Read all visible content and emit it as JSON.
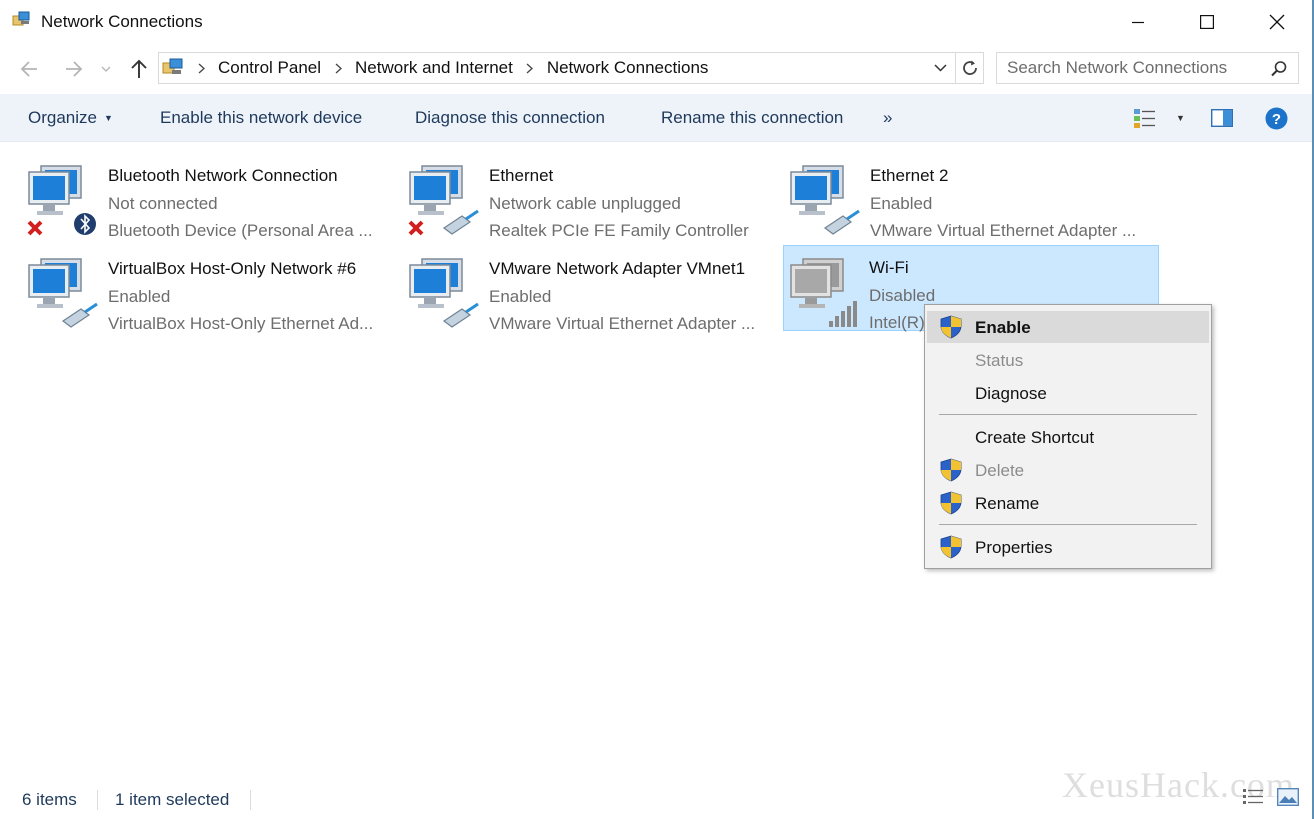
{
  "window": {
    "title": "Network Connections"
  },
  "nav": {
    "breadcrumbs": [
      "Control Panel",
      "Network and Internet",
      "Network Connections"
    ],
    "search_placeholder": "Search Network Connections"
  },
  "commands": {
    "organize": "Organize",
    "enable_device": "Enable this network device",
    "diagnose": "Diagnose this connection",
    "rename": "Rename this connection",
    "more": "»"
  },
  "connections": [
    {
      "name": "Bluetooth Network Connection",
      "status": "Not connected",
      "device": "Bluetooth Device (Personal Area ...",
      "icon": "bluetooth-adapter-icon",
      "state": "disconnected"
    },
    {
      "name": "Ethernet",
      "status": "Network cable unplugged",
      "device": "Realtek PCIe FE Family Controller",
      "icon": "ethernet-adapter-icon",
      "state": "disconnected"
    },
    {
      "name": "Ethernet 2",
      "status": "Enabled",
      "device": "VMware Virtual Ethernet Adapter ...",
      "icon": "ethernet-adapter-icon",
      "state": "enabled"
    },
    {
      "name": "VirtualBox Host-Only Network #6",
      "status": "Enabled",
      "device": "VirtualBox Host-Only Ethernet Ad...",
      "icon": "ethernet-adapter-icon",
      "state": "enabled"
    },
    {
      "name": "VMware Network Adapter VMnet1",
      "status": "Enabled",
      "device": "VMware Virtual Ethernet Adapter ...",
      "icon": "ethernet-adapter-icon",
      "state": "enabled"
    },
    {
      "name": "Wi-Fi",
      "status": "Disabled",
      "device": "Intel(R)",
      "icon": "wifi-adapter-icon",
      "state": "disabled",
      "selected": true
    }
  ],
  "context_menu": {
    "items": [
      {
        "label": "Enable",
        "shield": true,
        "bold": true,
        "highlighted": true
      },
      {
        "label": "Status",
        "disabled": true
      },
      {
        "label": "Diagnose"
      },
      {
        "label": "Create Shortcut"
      },
      {
        "label": "Delete",
        "shield": true,
        "disabled": true
      },
      {
        "label": "Rename",
        "shield": true
      },
      {
        "label": "Properties",
        "shield": true
      }
    ]
  },
  "statusbar": {
    "count": "6 items",
    "selected": "1 item selected"
  },
  "watermark": "XeusHack.com",
  "colors": {
    "command_text": "#1e395b",
    "command_bar_bg": "#eef3f9",
    "selection_bg": "#cce8ff",
    "selection_border": "#99d1ff",
    "help_blue": "#1c73c9",
    "error_red": "#d21f1f"
  }
}
